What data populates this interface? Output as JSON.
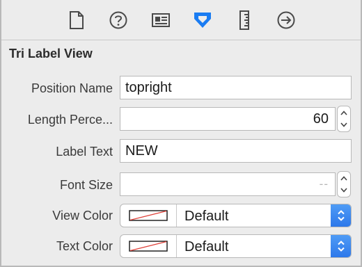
{
  "toolbar": {
    "icons": [
      "file-icon",
      "help-icon",
      "identity-icon",
      "attributes-icon",
      "size-ruler-icon",
      "connections-icon"
    ],
    "active_icon": "attributes-icon",
    "accent_color": "#1a7cf2"
  },
  "section": {
    "title": "Tri Label View"
  },
  "fields": {
    "position_name": {
      "label": "Position Name",
      "value": "topright"
    },
    "length_percent": {
      "label": "Length Perce...",
      "value": "60"
    },
    "label_text": {
      "label": "Label Text",
      "value": "NEW"
    },
    "font_size": {
      "label": "Font Size",
      "placeholder": "--"
    },
    "view_color": {
      "label": "View Color",
      "value": "Default"
    },
    "text_color": {
      "label": "Text Color",
      "value": "Default"
    }
  }
}
